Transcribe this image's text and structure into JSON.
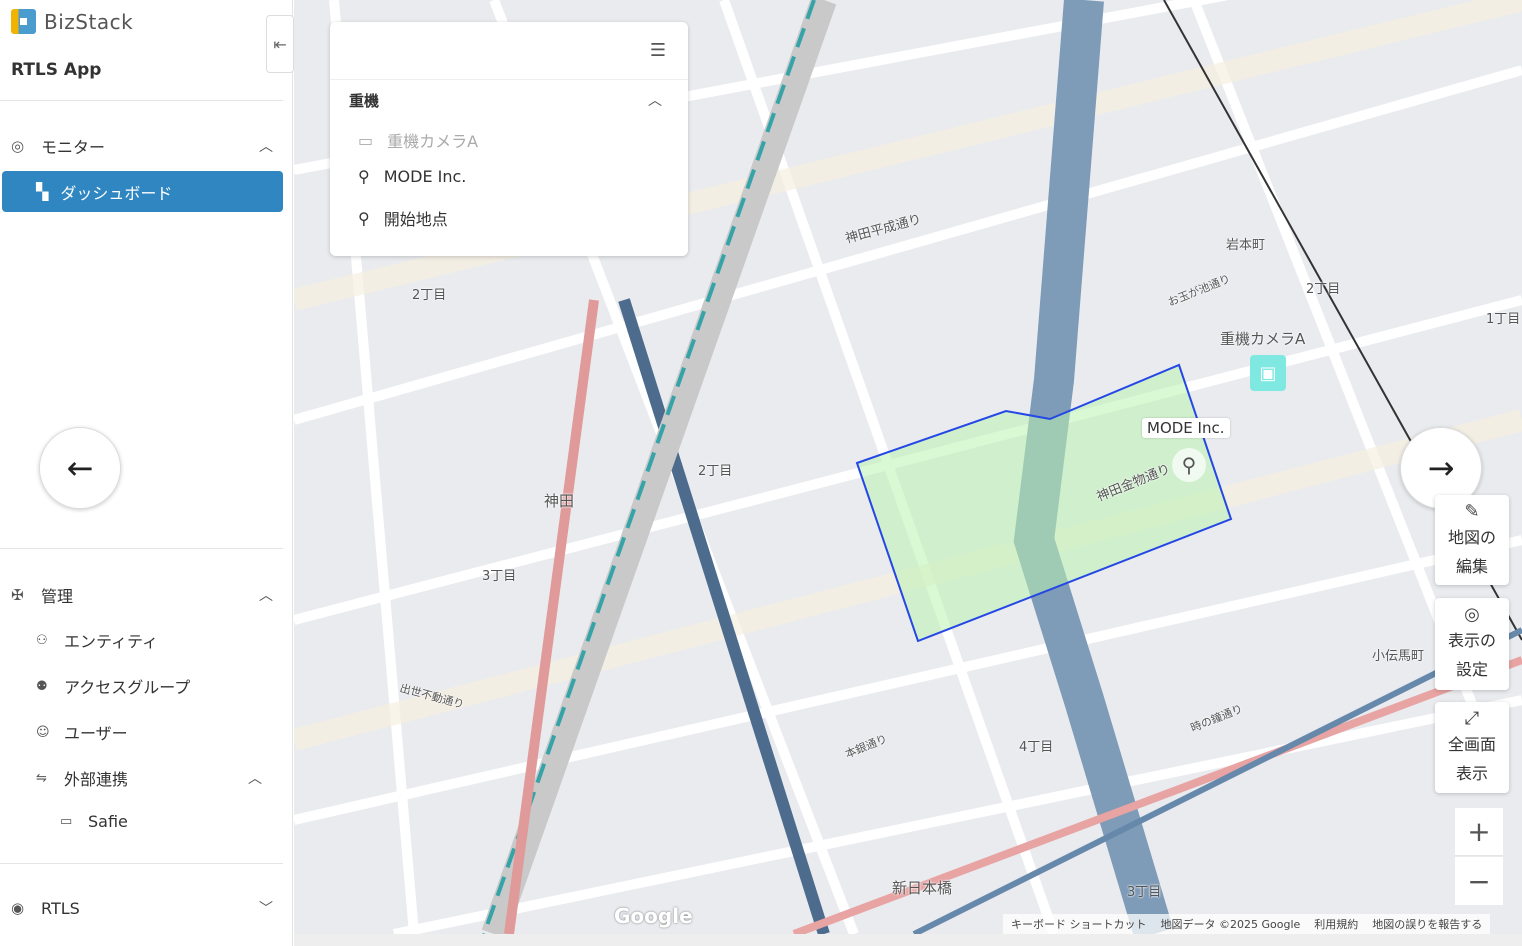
{
  "sidebar": {
    "brand": "BizStack",
    "app": "RTLS App",
    "collapse_icon": "collapse-menu-icon",
    "monitor": {
      "label": "モニター",
      "items": [
        {
          "label": "ダッシュボード",
          "active": true
        }
      ]
    },
    "admin": {
      "label": "管理",
      "items": [
        {
          "label": "エンティティ"
        },
        {
          "label": "アクセスグループ"
        },
        {
          "label": "ユーザー"
        },
        {
          "label": "外部連携"
        }
      ],
      "external": [
        {
          "label": "Safie"
        }
      ]
    },
    "rtls": {
      "label": "RTLS"
    }
  },
  "panel": {
    "group": "重機",
    "items": [
      {
        "label": "重機カメラA",
        "icon": "camera-icon",
        "dim": true
      },
      {
        "label": "MODE Inc.",
        "icon": "pin-icon"
      },
      {
        "label": "開始地点",
        "icon": "pin-icon"
      }
    ]
  },
  "map": {
    "markers": {
      "camera": "重機カメラA",
      "mode": "MODE Inc."
    },
    "labels": [
      "神田平成通り",
      "岩本町",
      "2丁目",
      "3丁目",
      "4丁目",
      "神田",
      "新日本橋",
      "小伝馬町",
      "お玉が池通り",
      "時の鐘通り",
      "本銀通り",
      "出世不動通り",
      "神田金物通り",
      "1丁目"
    ],
    "controls": {
      "edit": [
        "地図の",
        "編集"
      ],
      "display": [
        "表示の",
        "設定"
      ],
      "fullscreen": [
        "全画面",
        "表示"
      ],
      "zoom_in": "+",
      "zoom_out": "−"
    },
    "attribution": [
      "キーボード ショートカット",
      "地図データ ©2025 Google",
      "利用規約",
      "地図の誤りを報告する"
    ],
    "google": "Google"
  },
  "colors": {
    "accent": "#2f86c0",
    "polygon": "#2447e6",
    "fill": "#b9f3b0"
  }
}
